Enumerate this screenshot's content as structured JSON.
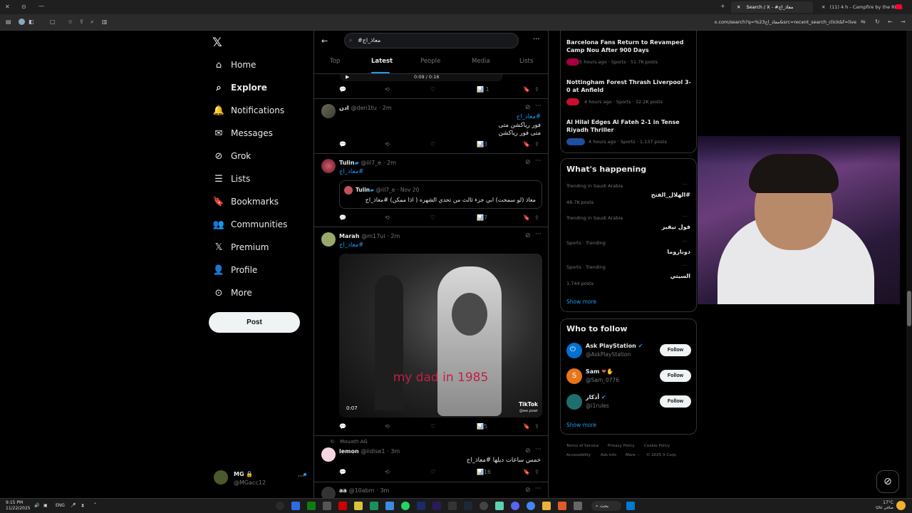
{
  "browser": {
    "tabs": [
      {
        "label": "Search / X - #معاذ_اج"
      },
      {
        "label": "(11) 4 h - Campfire by the Riv..."
      }
    ],
    "url": "x.com/search?q=%23معاذ_اج&src=recent_search_click&f=live"
  },
  "nav": {
    "items": [
      {
        "label": "Home",
        "icon": "home-icon"
      },
      {
        "label": "Explore",
        "icon": "search-icon"
      },
      {
        "label": "Notifications",
        "icon": "bell-icon"
      },
      {
        "label": "Messages",
        "icon": "mail-icon"
      },
      {
        "label": "Grok",
        "icon": "grok-icon"
      },
      {
        "label": "Lists",
        "icon": "list-icon"
      },
      {
        "label": "Bookmarks",
        "icon": "bookmark-icon"
      },
      {
        "label": "Communities",
        "icon": "people-icon"
      },
      {
        "label": "Premium",
        "icon": "x-icon"
      },
      {
        "label": "Profile",
        "icon": "user-icon"
      },
      {
        "label": "More",
        "icon": "more-circle-icon"
      }
    ],
    "post_label": "Post",
    "account": {
      "name": "MG",
      "handle": "@MGacc12"
    }
  },
  "search": {
    "query": "#معاذ_اج",
    "tabs": [
      "Top",
      "Latest",
      "People",
      "Media",
      "Lists"
    ],
    "active_tab": "Latest"
  },
  "video_top": {
    "time": "0:09 / 0:16"
  },
  "posts": [
    {
      "name": "ادن",
      "handle": "@den1tu",
      "time": "2m",
      "lines": [
        "#معاذ_اج",
        "فور رياكشن متى",
        "متى فور رياكشن"
      ],
      "likes": "",
      "views": "3"
    },
    {
      "name": "Tulin",
      "handle": "@iil7_e",
      "time": "2m",
      "lines": [
        "#معاذ_اج"
      ],
      "quote": {
        "name": "Tulin",
        "handle": "@iil7_e",
        "date": "Nov 20",
        "text": "معاذ (لو سمحت) ابي جزء ثالث من تحدي الشهره ( اذا ممكن) #معاذ_اج"
      },
      "views": "7"
    },
    {
      "name": "Marah",
      "handle": "@m17ui",
      "time": "2m",
      "lines": [
        "#معاذ_اج"
      ],
      "video": {
        "caption": "my dad in 1985",
        "duration": "0:07",
        "watermark": "TikTok",
        "wm_handle": "@we.powr"
      },
      "views": "5"
    },
    {
      "repost_by": "Mouath AG",
      "name": "lemon",
      "handle": "@iidise1",
      "time": "3m",
      "lines": [
        "خمس ساعات ديلها #معاذ_اج"
      ],
      "views": "16"
    },
    {
      "name": "aa",
      "handle": "@10abm",
      "time": "3m"
    }
  ],
  "news": [
    {
      "title": "Barcelona Fans Return to Revamped Camp Nou After 900 Days",
      "meta": "5 hours ago · Sports · 51.7K posts"
    },
    {
      "title": "Nottingham Forest Thrash Liverpool 3-0 at Anfield",
      "meta": "4 hours ago · Sports · 32.2K posts"
    },
    {
      "title": "Al Hilal Edges Al Fateh 2-1 in Tense Riyadh Thriller",
      "meta": "4 hours ago · Sports · 1,137 posts"
    }
  ],
  "happening": {
    "title": "What's happening",
    "trends": [
      {
        "context": "Trending in Saudi Arabia",
        "name": "#الهلال_الفتح",
        "posts": "48.7K posts"
      },
      {
        "context": "Trending in Saudi Arabia",
        "name": "فول نيفيز",
        "posts": ""
      },
      {
        "context": "Sports · Trending",
        "name": "دوناروما",
        "posts": ""
      },
      {
        "context": "Sports · Trending",
        "name": "السيتي",
        "posts": "1,744 posts"
      }
    ],
    "show_more": "Show more"
  },
  "who_to_follow": {
    "title": "Who to follow",
    "accounts": [
      {
        "name": "Ask PlayStation",
        "handle": "@AskPlayStation"
      },
      {
        "name": "Sam",
        "handle": "@Sam_0776"
      },
      {
        "name": "أذكار",
        "handle": "@i1rules"
      }
    ],
    "follow_label": "Follow",
    "show_more": "Show more"
  },
  "footer": {
    "links": [
      "Terms of Service",
      "Privacy Policy",
      "Cookie Policy",
      "Accessibility",
      "Ads info",
      "More ···",
      "© 2025 X Corp."
    ]
  },
  "taskbar": {
    "time": "9:15 PM",
    "date": "11/22/2025",
    "lang": "ENG",
    "search": "بحث",
    "weather": "17°C",
    "weather_desc": "صافي غالبًا"
  },
  "colors": {
    "accent": "#1d9bf0",
    "bg": "#000000",
    "border": "#2f3336",
    "muted": "#71767b"
  }
}
